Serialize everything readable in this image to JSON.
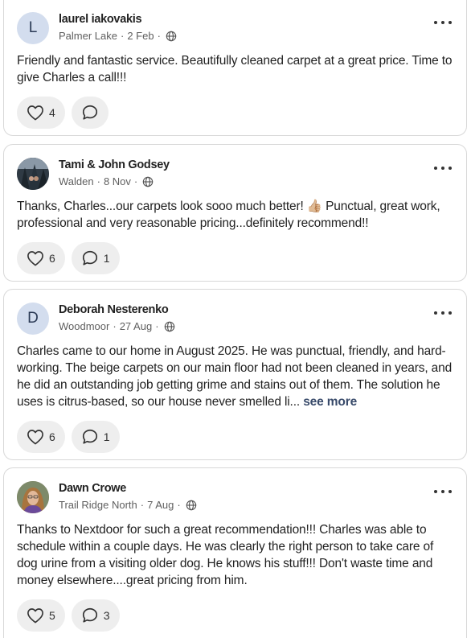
{
  "posts": [
    {
      "avatar_letter": "L",
      "name": "laurel iakovakis",
      "location": "Palmer Lake",
      "date": "2 Feb",
      "body": "Friendly and fantastic  service.  Beautifully cleaned carpet at a great price.  Time to give Charles a call!!!",
      "likes": "4",
      "comments": ""
    },
    {
      "avatar_letter": "",
      "name": "Tami & John Godsey",
      "location": "Walden",
      "date": "8 Nov",
      "body": "Thanks, Charles...our carpets look sooo much better! 👍🏼 Punctual, great work, professional and very reasonable pricing...definitely recommend!!",
      "likes": "6",
      "comments": "1"
    },
    {
      "avatar_letter": "D",
      "name": "Deborah Nesterenko",
      "location": "Woodmoor",
      "date": "27 Aug",
      "body": "Charles came to our home in August 2025.  He was punctual, friendly, and hard-working.  The beige carpets on our main floor had not been cleaned in years, and he did an outstanding job getting grime and stains out of them.  The solution he uses is citrus-based, so our house never smelled li...",
      "see_more": "see more",
      "likes": "6",
      "comments": "1"
    },
    {
      "avatar_letter": "",
      "name": "Dawn Crowe",
      "location": "Trail Ridge North",
      "date": "7 Aug",
      "body": "Thanks to Nextdoor for such a great recommendation!!! Charles was able to schedule within a couple days. He was clearly the right person to take care of dog urine from a visiting older dog. He knows his stuff!!! Don't waste time and money elsewhere....great pricing from him.",
      "likes": "5",
      "comments": "3"
    }
  ],
  "meta_separator": "·",
  "icons": {
    "more": "more-options-icon",
    "globe": "globe-icon",
    "like": "heart-icon",
    "comment": "comment-bubble-icon"
  }
}
